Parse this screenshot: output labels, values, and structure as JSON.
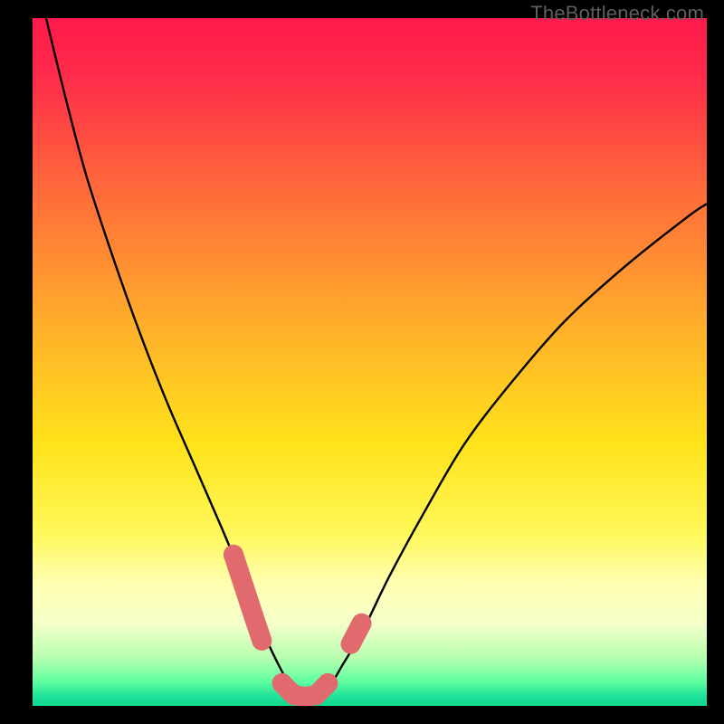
{
  "watermark": "TheBottleneck.com",
  "chart_data": {
    "type": "line",
    "title": "",
    "xlabel": "",
    "ylabel": "",
    "xlim": [
      0,
      100
    ],
    "ylim": [
      0,
      100
    ],
    "gradient_stops": [
      {
        "offset": 0,
        "color": "#ff1a4b"
      },
      {
        "offset": 0.08,
        "color": "#ff2a4a"
      },
      {
        "offset": 0.25,
        "color": "#ff6a3a"
      },
      {
        "offset": 0.45,
        "color": "#ffb02a"
      },
      {
        "offset": 0.62,
        "color": "#ffe31a"
      },
      {
        "offset": 0.75,
        "color": "#fff85a"
      },
      {
        "offset": 0.82,
        "color": "#ffffb0"
      },
      {
        "offset": 0.88,
        "color": "#f4ffc8"
      },
      {
        "offset": 0.93,
        "color": "#b8ffb0"
      },
      {
        "offset": 0.965,
        "color": "#5effa0"
      },
      {
        "offset": 0.985,
        "color": "#22e39a"
      },
      {
        "offset": 1.0,
        "color": "#0fd88f"
      }
    ],
    "series": [
      {
        "name": "bottleneck-curve",
        "x": [
          2,
          5,
          8,
          12,
          16,
          20,
          24,
          28,
          31,
          33,
          35,
          37,
          38.5,
          40,
          42,
          44,
          46,
          49,
          53,
          58,
          64,
          71,
          79,
          88,
          97,
          100
        ],
        "y": [
          100,
          88,
          77,
          65,
          54,
          44,
          35,
          26,
          19,
          14,
          9,
          5,
          2.5,
          1.3,
          1.3,
          2.8,
          6,
          11,
          19,
          28,
          38,
          47,
          56,
          64,
          71,
          73
        ]
      }
    ],
    "marker_segments": [
      {
        "name": "left-descent-markers",
        "x": [
          29.8,
          31.3,
          32.8,
          34.0
        ],
        "y": [
          22.0,
          17.5,
          13.0,
          9.5
        ]
      },
      {
        "name": "valley-markers",
        "x": [
          37.0,
          38.7,
          40.4,
          42.1,
          43.8
        ],
        "y": [
          3.3,
          1.6,
          1.3,
          1.6,
          3.3
        ]
      },
      {
        "name": "right-ascent-markers",
        "x": [
          47.2,
          48.8
        ],
        "y": [
          9.0,
          12.0
        ]
      }
    ],
    "colors": {
      "curve": "#000000",
      "marker": "#e06a6d",
      "background_frame": "#000000"
    }
  }
}
